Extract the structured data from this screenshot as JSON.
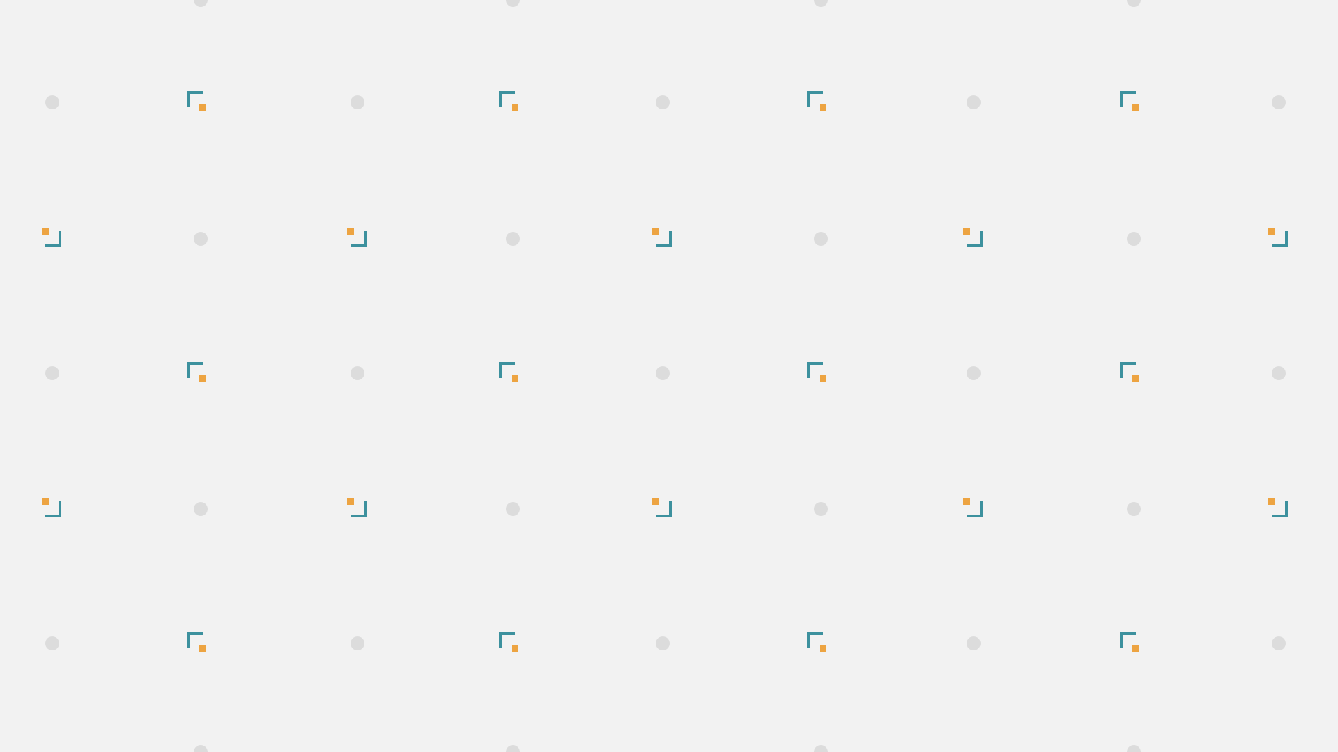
{
  "pattern": {
    "name": "corner-bracket-dot-pattern",
    "colors": {
      "background": "#f2f2f2",
      "dot": "#dcdcdc",
      "bracket": "#3d919e",
      "accent": "#eda442"
    },
    "rows": [
      "dots-offset",
      "brackets-top-left",
      "brackets-bottom-right",
      "brackets-top-left",
      "brackets-bottom-right",
      "brackets-top-left",
      "dots-offset"
    ]
  }
}
